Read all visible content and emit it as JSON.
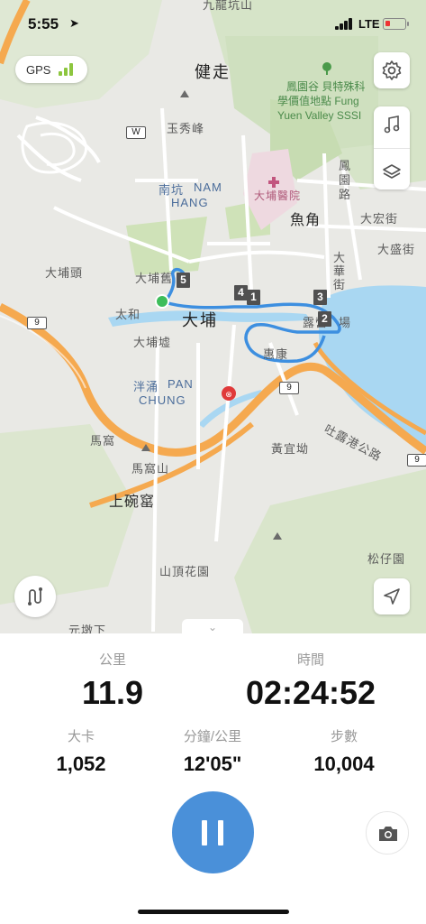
{
  "status_bar": {
    "time": "5:55",
    "network": "LTE"
  },
  "gps": {
    "label": "GPS",
    "signal_color": "#8dc63f"
  },
  "controls": {
    "settings_icon": "gear-icon",
    "music_icon": "music-note-icon",
    "layers_icon": "layers-icon",
    "route_icon": "route-icon",
    "locate_icon": "navigation-arrow-icon"
  },
  "map": {
    "labels": {
      "top_cut": "九龍坑山",
      "jianzou": "健走",
      "fung_yuen_1": "鳳園谷 貝特殊科",
      "fung_yuen_2": "學價值地點 Fung",
      "fung_yuen_3": "Yuen Valley SSSI",
      "yuk_sau": "玉秀峰",
      "nam_hang_cn": "南坑",
      "nam_hang_en_1": "NAM",
      "nam_hang_en_2": "HANG",
      "hospital": "大埔醫院",
      "yu_kok": "魚角",
      "fung_yuen_rd": "鳳園路",
      "tai_wang": "大宏街",
      "tai_sing": "大盛街",
      "tai_wah": "大華街",
      "tai_po_tau": "大埔頭",
      "tai_po_old": "大埔舊",
      "tai_wo": "太和",
      "tai_po": "大埔",
      "tai_po_hui": "大埔墟",
      "lu_ying": "露營",
      "chang": "場",
      "wai_hong": "惠康",
      "pan_chung_cn": "泮涌",
      "pan_chung_en_1": "PAN",
      "pan_chung_en_2": "CHUNG",
      "tolo_hwy": "吐露港公路",
      "ma_wo": "馬窩",
      "ma_wo_shan": "馬窩山",
      "wong_yi_au": "黃宜坳",
      "sheung_wun_yiu": "上碗窰",
      "shan_ting": "山頂花園",
      "chung_tsai_yuen": "松仔園",
      "yuen_tun_ha": "元墩下"
    },
    "shields": {
      "w": "W",
      "route9a": "9",
      "route9b": "9",
      "route9c": "9"
    },
    "markers": [
      "1",
      "2",
      "3",
      "4",
      "5"
    ],
    "route_color": "#3d8fe0",
    "water_color": "#a9d7f2"
  },
  "stats": {
    "distance_label": "公里",
    "distance_value": "11.9",
    "time_label": "時間",
    "time_value": "02:24:52",
    "calories_label": "大卡",
    "calories_value": "1,052",
    "pace_label": "分鐘/公里",
    "pace_value": "12'05\"",
    "steps_label": "步數",
    "steps_value": "10,004"
  },
  "colors": {
    "accent": "#4a90d9"
  }
}
